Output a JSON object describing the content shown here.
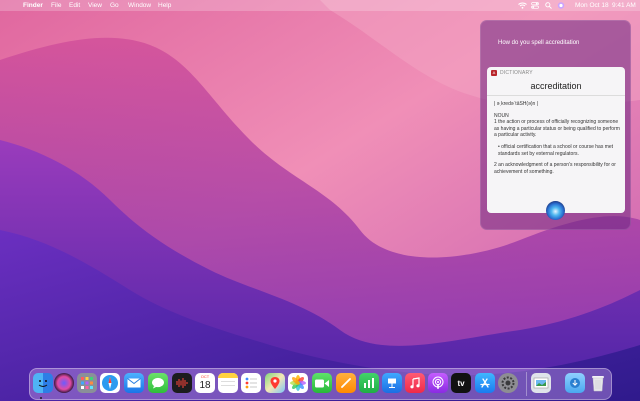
{
  "menubar": {
    "apple": "",
    "app_name": "Finder",
    "menus": [
      "File",
      "Edit",
      "View",
      "Go",
      "Window",
      "Help"
    ],
    "status": {
      "datetime_day": "Mon Oct 18",
      "time": "9:41 AM"
    }
  },
  "siri": {
    "query": "How do you spell accreditation",
    "dictionary": {
      "label": "DICTIONARY",
      "word": "accreditation",
      "pronunciation": "| əˌkredəˈtāSH(ə)n |",
      "pos": "NOUN",
      "def1": "1  the action or process of officially recognizing someone as having a particular status or being qualified to perform a particular activity.",
      "def1_sub": "•  official certification that a school or course has met standards set by external regulators.",
      "def2": "2  an acknowledgment of a person's responsibility for or achievement of something."
    }
  },
  "dock": {
    "calendar_month": "OCT",
    "calendar_day": "18",
    "tv_label": "tv",
    "apps": [
      "Finder",
      "Siri",
      "Launchpad",
      "Safari",
      "Mail",
      "Messages",
      "Voice Memos",
      "Calendar",
      "Notes",
      "Reminders",
      "Maps",
      "Photos",
      "FaceTime",
      "Pages",
      "Numbers",
      "Keynote",
      "Music",
      "Podcasts",
      "TV",
      "App Store",
      "System Preferences",
      "Preview",
      "Downloads",
      "Trash"
    ]
  }
}
